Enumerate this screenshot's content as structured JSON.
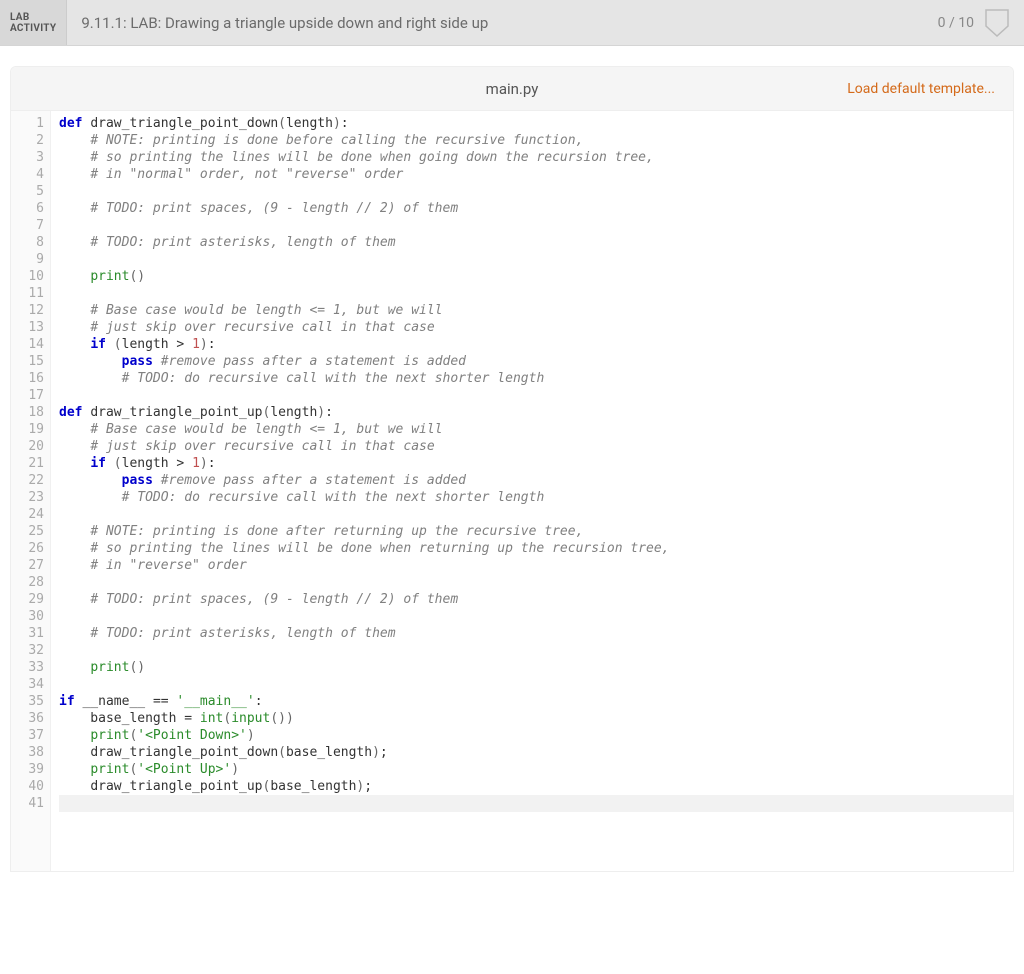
{
  "header": {
    "badge_line1": "LAB",
    "badge_line2": "ACTIVITY",
    "title": "9.11.1: LAB: Drawing a triangle upside down and right side up",
    "score": "0 / 10"
  },
  "editor": {
    "filename": "main.py",
    "load_link": "Load default template...",
    "code_lines": [
      [
        [
          "kw",
          "def"
        ],
        [
          "txt",
          " "
        ],
        [
          "fn",
          "draw_triangle_point_down"
        ],
        [
          "par",
          "("
        ],
        [
          "txt",
          "length"
        ],
        [
          "par",
          ")"
        ],
        [
          "txt",
          ":"
        ]
      ],
      [
        [
          "txt",
          "    "
        ],
        [
          "cmt",
          "# NOTE: printing is done before calling the recursive function,"
        ]
      ],
      [
        [
          "txt",
          "    "
        ],
        [
          "cmt",
          "# so printing the lines will be done when going down the recursion tree,"
        ]
      ],
      [
        [
          "txt",
          "    "
        ],
        [
          "cmt",
          "# in \"normal\" order, not \"reverse\" order"
        ]
      ],
      [],
      [
        [
          "txt",
          "    "
        ],
        [
          "cmt",
          "# TODO: print spaces, (9 - length // 2) of them"
        ]
      ],
      [],
      [
        [
          "txt",
          "    "
        ],
        [
          "cmt",
          "# TODO: print asterisks, length of them"
        ]
      ],
      [],
      [
        [
          "txt",
          "    "
        ],
        [
          "bi",
          "print"
        ],
        [
          "par",
          "()"
        ]
      ],
      [],
      [
        [
          "txt",
          "    "
        ],
        [
          "cmt",
          "# Base case would be length <= 1, but we will"
        ]
      ],
      [
        [
          "txt",
          "    "
        ],
        [
          "cmt",
          "# just skip over recursive call in that case"
        ]
      ],
      [
        [
          "txt",
          "    "
        ],
        [
          "kw",
          "if"
        ],
        [
          "txt",
          " "
        ],
        [
          "par",
          "("
        ],
        [
          "txt",
          "length "
        ],
        [
          "txt",
          "> "
        ],
        [
          "num",
          "1"
        ],
        [
          "par",
          ")"
        ],
        [
          "txt",
          ":"
        ]
      ],
      [
        [
          "txt",
          "        "
        ],
        [
          "kw",
          "pass"
        ],
        [
          "txt",
          " "
        ],
        [
          "cmt",
          "#remove pass after a statement is added"
        ]
      ],
      [
        [
          "txt",
          "        "
        ],
        [
          "cmt",
          "# TODO: do recursive call with the next shorter length"
        ]
      ],
      [],
      [
        [
          "kw",
          "def"
        ],
        [
          "txt",
          " "
        ],
        [
          "fn",
          "draw_triangle_point_up"
        ],
        [
          "par",
          "("
        ],
        [
          "txt",
          "length"
        ],
        [
          "par",
          ")"
        ],
        [
          "txt",
          ":"
        ]
      ],
      [
        [
          "txt",
          "    "
        ],
        [
          "cmt",
          "# Base case would be length <= 1, but we will"
        ]
      ],
      [
        [
          "txt",
          "    "
        ],
        [
          "cmt",
          "# just skip over recursive call in that case"
        ]
      ],
      [
        [
          "txt",
          "    "
        ],
        [
          "kw",
          "if"
        ],
        [
          "txt",
          " "
        ],
        [
          "par",
          "("
        ],
        [
          "txt",
          "length "
        ],
        [
          "txt",
          "> "
        ],
        [
          "num",
          "1"
        ],
        [
          "par",
          ")"
        ],
        [
          "txt",
          ":"
        ]
      ],
      [
        [
          "txt",
          "        "
        ],
        [
          "kw",
          "pass"
        ],
        [
          "txt",
          " "
        ],
        [
          "cmt",
          "#remove pass after a statement is added"
        ]
      ],
      [
        [
          "txt",
          "        "
        ],
        [
          "cmt",
          "# TODO: do recursive call with the next shorter length"
        ]
      ],
      [],
      [
        [
          "txt",
          "    "
        ],
        [
          "cmt",
          "# NOTE: printing is done after returning up the recursive tree,"
        ]
      ],
      [
        [
          "txt",
          "    "
        ],
        [
          "cmt",
          "# so printing the lines will be done when returning up the recursion tree,"
        ]
      ],
      [
        [
          "txt",
          "    "
        ],
        [
          "cmt",
          "# in \"reverse\" order"
        ]
      ],
      [],
      [
        [
          "txt",
          "    "
        ],
        [
          "cmt",
          "# TODO: print spaces, (9 - length // 2) of them"
        ]
      ],
      [],
      [
        [
          "txt",
          "    "
        ],
        [
          "cmt",
          "# TODO: print asterisks, length of them"
        ]
      ],
      [],
      [
        [
          "txt",
          "    "
        ],
        [
          "bi",
          "print"
        ],
        [
          "par",
          "()"
        ]
      ],
      [],
      [
        [
          "kw",
          "if"
        ],
        [
          "txt",
          " __name__ "
        ],
        [
          "txt",
          "== "
        ],
        [
          "str",
          "'__main__'"
        ],
        [
          "txt",
          ":"
        ]
      ],
      [
        [
          "txt",
          "    base_length "
        ],
        [
          "txt",
          "= "
        ],
        [
          "bi",
          "int"
        ],
        [
          "par",
          "("
        ],
        [
          "bi",
          "input"
        ],
        [
          "par",
          "())"
        ]
      ],
      [
        [
          "txt",
          "    "
        ],
        [
          "bi",
          "print"
        ],
        [
          "par",
          "("
        ],
        [
          "str",
          "'<Point Down>'"
        ],
        [
          "par",
          ")"
        ]
      ],
      [
        [
          "txt",
          "    "
        ],
        [
          "fn",
          "draw_triangle_point_down"
        ],
        [
          "par",
          "("
        ],
        [
          "txt",
          "base_length"
        ],
        [
          "par",
          ")"
        ],
        [
          "txt",
          ";"
        ]
      ],
      [
        [
          "txt",
          "    "
        ],
        [
          "bi",
          "print"
        ],
        [
          "par",
          "("
        ],
        [
          "str",
          "'<Point Up>'"
        ],
        [
          "par",
          ")"
        ]
      ],
      [
        [
          "txt",
          "    "
        ],
        [
          "fn",
          "draw_triangle_point_up"
        ],
        [
          "par",
          "("
        ],
        [
          "txt",
          "base_length"
        ],
        [
          "par",
          ")"
        ],
        [
          "txt",
          ";"
        ]
      ],
      []
    ],
    "highlight_line": 41
  }
}
